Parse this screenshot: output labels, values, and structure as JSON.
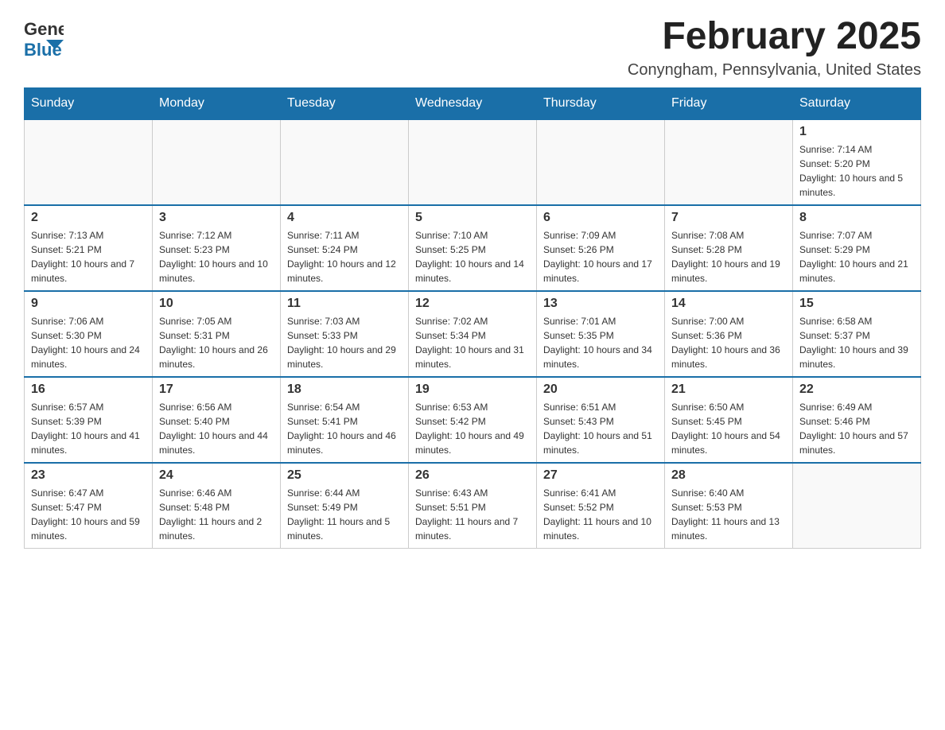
{
  "header": {
    "logo_general": "General",
    "logo_blue": "Blue",
    "title": "February 2025",
    "subtitle": "Conyngham, Pennsylvania, United States"
  },
  "days_of_week": [
    "Sunday",
    "Monday",
    "Tuesday",
    "Wednesday",
    "Thursday",
    "Friday",
    "Saturday"
  ],
  "weeks": [
    [
      {
        "day": "",
        "info": ""
      },
      {
        "day": "",
        "info": ""
      },
      {
        "day": "",
        "info": ""
      },
      {
        "day": "",
        "info": ""
      },
      {
        "day": "",
        "info": ""
      },
      {
        "day": "",
        "info": ""
      },
      {
        "day": "1",
        "info": "Sunrise: 7:14 AM\nSunset: 5:20 PM\nDaylight: 10 hours and 5 minutes."
      }
    ],
    [
      {
        "day": "2",
        "info": "Sunrise: 7:13 AM\nSunset: 5:21 PM\nDaylight: 10 hours and 7 minutes."
      },
      {
        "day": "3",
        "info": "Sunrise: 7:12 AM\nSunset: 5:23 PM\nDaylight: 10 hours and 10 minutes."
      },
      {
        "day": "4",
        "info": "Sunrise: 7:11 AM\nSunset: 5:24 PM\nDaylight: 10 hours and 12 minutes."
      },
      {
        "day": "5",
        "info": "Sunrise: 7:10 AM\nSunset: 5:25 PM\nDaylight: 10 hours and 14 minutes."
      },
      {
        "day": "6",
        "info": "Sunrise: 7:09 AM\nSunset: 5:26 PM\nDaylight: 10 hours and 17 minutes."
      },
      {
        "day": "7",
        "info": "Sunrise: 7:08 AM\nSunset: 5:28 PM\nDaylight: 10 hours and 19 minutes."
      },
      {
        "day": "8",
        "info": "Sunrise: 7:07 AM\nSunset: 5:29 PM\nDaylight: 10 hours and 21 minutes."
      }
    ],
    [
      {
        "day": "9",
        "info": "Sunrise: 7:06 AM\nSunset: 5:30 PM\nDaylight: 10 hours and 24 minutes."
      },
      {
        "day": "10",
        "info": "Sunrise: 7:05 AM\nSunset: 5:31 PM\nDaylight: 10 hours and 26 minutes."
      },
      {
        "day": "11",
        "info": "Sunrise: 7:03 AM\nSunset: 5:33 PM\nDaylight: 10 hours and 29 minutes."
      },
      {
        "day": "12",
        "info": "Sunrise: 7:02 AM\nSunset: 5:34 PM\nDaylight: 10 hours and 31 minutes."
      },
      {
        "day": "13",
        "info": "Sunrise: 7:01 AM\nSunset: 5:35 PM\nDaylight: 10 hours and 34 minutes."
      },
      {
        "day": "14",
        "info": "Sunrise: 7:00 AM\nSunset: 5:36 PM\nDaylight: 10 hours and 36 minutes."
      },
      {
        "day": "15",
        "info": "Sunrise: 6:58 AM\nSunset: 5:37 PM\nDaylight: 10 hours and 39 minutes."
      }
    ],
    [
      {
        "day": "16",
        "info": "Sunrise: 6:57 AM\nSunset: 5:39 PM\nDaylight: 10 hours and 41 minutes."
      },
      {
        "day": "17",
        "info": "Sunrise: 6:56 AM\nSunset: 5:40 PM\nDaylight: 10 hours and 44 minutes."
      },
      {
        "day": "18",
        "info": "Sunrise: 6:54 AM\nSunset: 5:41 PM\nDaylight: 10 hours and 46 minutes."
      },
      {
        "day": "19",
        "info": "Sunrise: 6:53 AM\nSunset: 5:42 PM\nDaylight: 10 hours and 49 minutes."
      },
      {
        "day": "20",
        "info": "Sunrise: 6:51 AM\nSunset: 5:43 PM\nDaylight: 10 hours and 51 minutes."
      },
      {
        "day": "21",
        "info": "Sunrise: 6:50 AM\nSunset: 5:45 PM\nDaylight: 10 hours and 54 minutes."
      },
      {
        "day": "22",
        "info": "Sunrise: 6:49 AM\nSunset: 5:46 PM\nDaylight: 10 hours and 57 minutes."
      }
    ],
    [
      {
        "day": "23",
        "info": "Sunrise: 6:47 AM\nSunset: 5:47 PM\nDaylight: 10 hours and 59 minutes."
      },
      {
        "day": "24",
        "info": "Sunrise: 6:46 AM\nSunset: 5:48 PM\nDaylight: 11 hours and 2 minutes."
      },
      {
        "day": "25",
        "info": "Sunrise: 6:44 AM\nSunset: 5:49 PM\nDaylight: 11 hours and 5 minutes."
      },
      {
        "day": "26",
        "info": "Sunrise: 6:43 AM\nSunset: 5:51 PM\nDaylight: 11 hours and 7 minutes."
      },
      {
        "day": "27",
        "info": "Sunrise: 6:41 AM\nSunset: 5:52 PM\nDaylight: 11 hours and 10 minutes."
      },
      {
        "day": "28",
        "info": "Sunrise: 6:40 AM\nSunset: 5:53 PM\nDaylight: 11 hours and 13 minutes."
      },
      {
        "day": "",
        "info": ""
      }
    ]
  ]
}
